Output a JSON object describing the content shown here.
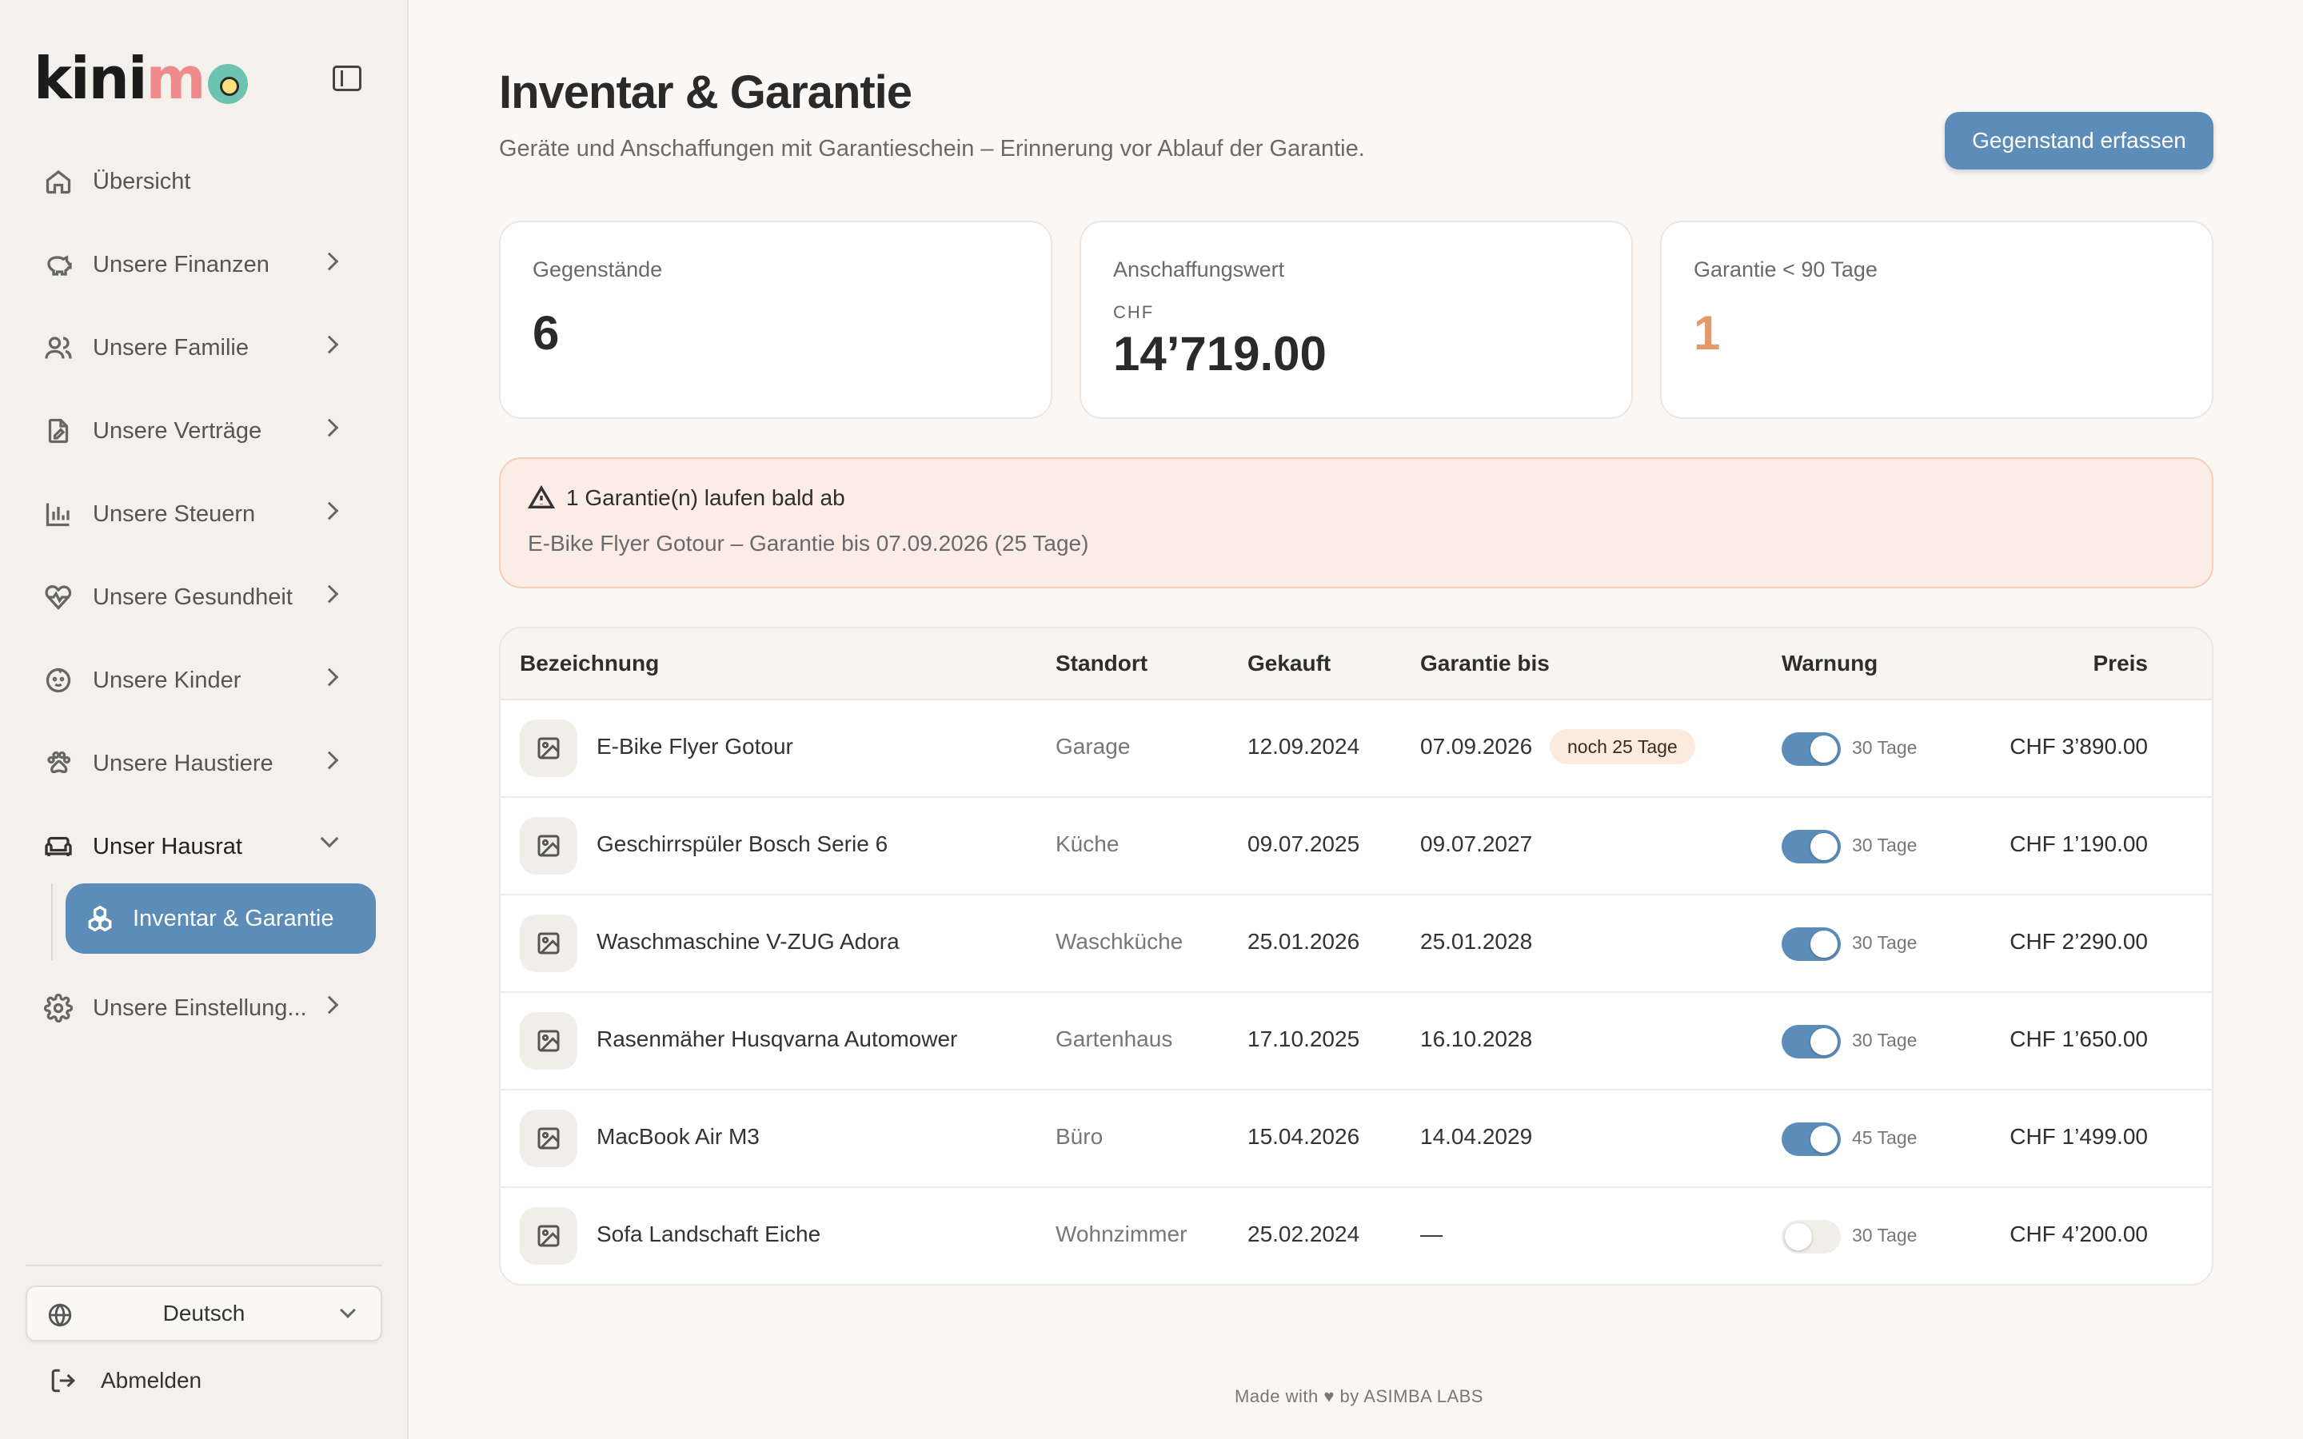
{
  "sidebar": {
    "logo": {
      "part1": "kini",
      "part2": "m"
    },
    "items": [
      {
        "label": "Übersicht",
        "icon": "home-icon"
      },
      {
        "label": "Unsere Finanzen",
        "icon": "piggy-bank-icon"
      },
      {
        "label": "Unsere Familie",
        "icon": "users-icon"
      },
      {
        "label": "Unsere Verträge",
        "icon": "document-edit-icon"
      },
      {
        "label": "Unsere Steuern",
        "icon": "bar-chart-icon"
      },
      {
        "label": "Unsere Gesundheit",
        "icon": "heart-pulse-icon"
      },
      {
        "label": "Unsere Kinder",
        "icon": "baby-icon"
      },
      {
        "label": "Unsere Haustiere",
        "icon": "paw-icon"
      },
      {
        "label": "Unser Hausrat",
        "icon": "sofa-icon"
      },
      {
        "label": "Unsere Einstellung...",
        "icon": "gear-icon"
      }
    ],
    "sub_active": {
      "label": "Inventar & Garantie",
      "icon": "boxes-icon"
    },
    "language": "Deutsch",
    "logout": "Abmelden"
  },
  "header": {
    "title": "Inventar & Garantie",
    "subtitle": "Geräte und Anschaffungen mit Garantieschein – Erinnerung vor Ablauf der Garantie.",
    "primary_button": "Gegenstand erfassen"
  },
  "stats": {
    "items": {
      "label": "Gegenstände",
      "value": "6"
    },
    "value": {
      "label": "Anschaffungswert",
      "currency": "CHF",
      "value": "14’719.00"
    },
    "warranty": {
      "label": "Garantie < 90 Tage",
      "value": "1"
    }
  },
  "alert": {
    "title": "1 Garantie(n) laufen bald ab",
    "body": "E-Bike Flyer Gotour – Garantie bis 07.09.2026 (25 Tage)"
  },
  "table": {
    "headers": {
      "name": "Bezeichnung",
      "location": "Standort",
      "bought": "Gekauft",
      "warranty": "Garantie bis",
      "warning": "Warnung",
      "price": "Preis"
    },
    "rows": [
      {
        "name": "E-Bike Flyer Gotour",
        "location": "Garage",
        "bought": "12.09.2024",
        "warranty": "07.09.2026",
        "badge": "noch 25 Tage",
        "toggle": true,
        "days": "30 Tage",
        "price": "CHF 3’890.00"
      },
      {
        "name": "Geschirrspüler Bosch Serie 6",
        "location": "Küche",
        "bought": "09.07.2025",
        "warranty": "09.07.2027",
        "toggle": true,
        "days": "30 Tage",
        "price": "CHF 1’190.00"
      },
      {
        "name": "Waschmaschine V-ZUG Adora",
        "location": "Waschküche",
        "bought": "25.01.2026",
        "warranty": "25.01.2028",
        "toggle": true,
        "days": "30 Tage",
        "price": "CHF 2’290.00"
      },
      {
        "name": "Rasenmäher Husqvarna Automower",
        "location": "Gartenhaus",
        "bought": "17.10.2025",
        "warranty": "16.10.2028",
        "toggle": true,
        "days": "30 Tage",
        "price": "CHF 1’650.00"
      },
      {
        "name": "MacBook Air M3",
        "location": "Büro",
        "bought": "15.04.2026",
        "warranty": "14.04.2029",
        "toggle": true,
        "days": "45 Tage",
        "price": "CHF 1’499.00"
      },
      {
        "name": "Sofa Landschaft Eiche",
        "location": "Wohnzimmer",
        "bought": "25.02.2024",
        "warranty": "—",
        "toggle": false,
        "days": "30 Tage",
        "price": "CHF 4’200.00"
      }
    ]
  },
  "footer": "Made with ♥ by ASIMBA LABS",
  "colors": {
    "accent": "#5b8db8",
    "warn": "#e29a6c",
    "alert_bg": "#fbece5"
  }
}
